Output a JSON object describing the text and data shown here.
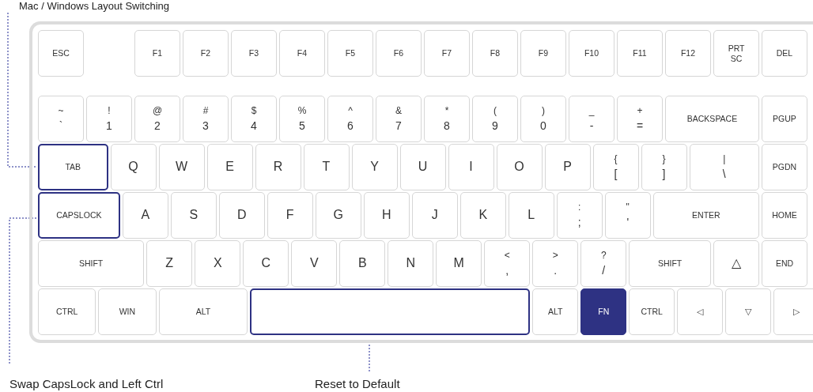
{
  "captions": [
    {
      "text": "Mac / Windows Layout Switching"
    },
    {
      "text": "Swap CapsLock and Left Ctrl"
    },
    {
      "text": "Reset to Default"
    }
  ],
  "keyboard": {
    "rows": [
      [
        {
          "label": "ESC",
          "kind": "plain"
        },
        {
          "label": "F1",
          "kind": "plain"
        },
        {
          "label": "F2",
          "kind": "plain"
        },
        {
          "label": "F3",
          "kind": "plain"
        },
        {
          "label": "F4",
          "kind": "plain"
        },
        {
          "label": "F5",
          "kind": "plain"
        },
        {
          "label": "F6",
          "kind": "plain"
        },
        {
          "label": "F7",
          "kind": "plain"
        },
        {
          "label": "F8",
          "kind": "plain"
        },
        {
          "label": "F9",
          "kind": "plain"
        },
        {
          "label": "F10",
          "kind": "plain"
        },
        {
          "label": "F11",
          "kind": "plain"
        },
        {
          "label": "F12",
          "kind": "plain"
        },
        {
          "label": "PRT SC",
          "kind": "plain"
        },
        {
          "label": "DEL",
          "kind": "plain"
        }
      ],
      [
        {
          "shift": "~",
          "label": "`",
          "kind": "plain"
        },
        {
          "shift": "!",
          "label": "1",
          "kind": "plain"
        },
        {
          "shift": "@",
          "label": "2",
          "kind": "plain"
        },
        {
          "shift": "#",
          "label": "3",
          "kind": "plain"
        },
        {
          "shift": "$",
          "label": "4",
          "kind": "plain"
        },
        {
          "shift": "%",
          "label": "5",
          "kind": "plain"
        },
        {
          "shift": "^",
          "label": "6",
          "kind": "plain"
        },
        {
          "shift": "&",
          "label": "7",
          "kind": "plain"
        },
        {
          "shift": "*",
          "label": "8",
          "kind": "plain"
        },
        {
          "shift": "(",
          "label": "9",
          "kind": "plain"
        },
        {
          "shift": ")",
          "label": "0",
          "kind": "plain"
        },
        {
          "shift": "_",
          "label": "-",
          "kind": "plain"
        },
        {
          "shift": "+",
          "label": "=",
          "kind": "plain"
        },
        {
          "label": "BACKSPACE",
          "kind": "plain"
        },
        {
          "label": "PGUP",
          "kind": "plain"
        }
      ],
      [
        {
          "label": "TAB",
          "kind": "outline"
        },
        {
          "label": "Q",
          "kind": "plain"
        },
        {
          "label": "W",
          "kind": "plain"
        },
        {
          "label": "E",
          "kind": "plain"
        },
        {
          "label": "R",
          "kind": "plain"
        },
        {
          "label": "T",
          "kind": "plain"
        },
        {
          "label": "Y",
          "kind": "plain"
        },
        {
          "label": "U",
          "kind": "plain"
        },
        {
          "label": "I",
          "kind": "plain"
        },
        {
          "label": "O",
          "kind": "plain"
        },
        {
          "label": "P",
          "kind": "plain"
        },
        {
          "shift": "{",
          "label": "[",
          "kind": "plain"
        },
        {
          "shift": "}",
          "label": "]",
          "kind": "plain"
        },
        {
          "shift": "|",
          "label": "\\",
          "kind": "plain"
        },
        {
          "label": "PGDN",
          "kind": "plain"
        }
      ],
      [
        {
          "label": "CAPSLOCK",
          "kind": "outline"
        },
        {
          "label": "A",
          "kind": "plain"
        },
        {
          "label": "S",
          "kind": "plain"
        },
        {
          "label": "D",
          "kind": "plain"
        },
        {
          "label": "F",
          "kind": "plain"
        },
        {
          "label": "G",
          "kind": "plain"
        },
        {
          "label": "H",
          "kind": "plain"
        },
        {
          "label": "J",
          "kind": "plain"
        },
        {
          "label": "K",
          "kind": "plain"
        },
        {
          "label": "L",
          "kind": "plain"
        },
        {
          "shift": ":",
          "label": ";",
          "kind": "plain"
        },
        {
          "shift": "\"",
          "label": "'",
          "kind": "plain"
        },
        {
          "label": "ENTER",
          "kind": "plain"
        },
        {
          "label": "HOME",
          "kind": "plain"
        }
      ],
      [
        {
          "label": "SHIFT",
          "kind": "plain"
        },
        {
          "label": "Z",
          "kind": "plain"
        },
        {
          "label": "X",
          "kind": "plain"
        },
        {
          "label": "C",
          "kind": "plain"
        },
        {
          "label": "V",
          "kind": "plain"
        },
        {
          "label": "B",
          "kind": "plain"
        },
        {
          "label": "N",
          "kind": "plain"
        },
        {
          "label": "M",
          "kind": "plain"
        },
        {
          "shift": "<",
          "label": ",",
          "kind": "plain"
        },
        {
          "shift": ">",
          "label": ".",
          "kind": "plain"
        },
        {
          "shift": "?",
          "label": "/",
          "kind": "plain"
        },
        {
          "label": "SHIFT",
          "kind": "plain"
        },
        {
          "label": "△",
          "kind": "plain"
        },
        {
          "label": "END",
          "kind": "plain"
        }
      ],
      [
        {
          "label": "CTRL",
          "kind": "plain"
        },
        {
          "label": "WIN",
          "kind": "plain"
        },
        {
          "label": "ALT",
          "kind": "plain"
        },
        {
          "kind": "outline"
        },
        {
          "label": "ALT",
          "kind": "plain"
        },
        {
          "label": "FN",
          "kind": "filled"
        },
        {
          "label": "CTRL",
          "kind": "plain"
        },
        {
          "label": "◁",
          "kind": "plain"
        },
        {
          "label": "▽",
          "kind": "plain"
        },
        {
          "label": "▷",
          "kind": "plain"
        }
      ]
    ]
  }
}
